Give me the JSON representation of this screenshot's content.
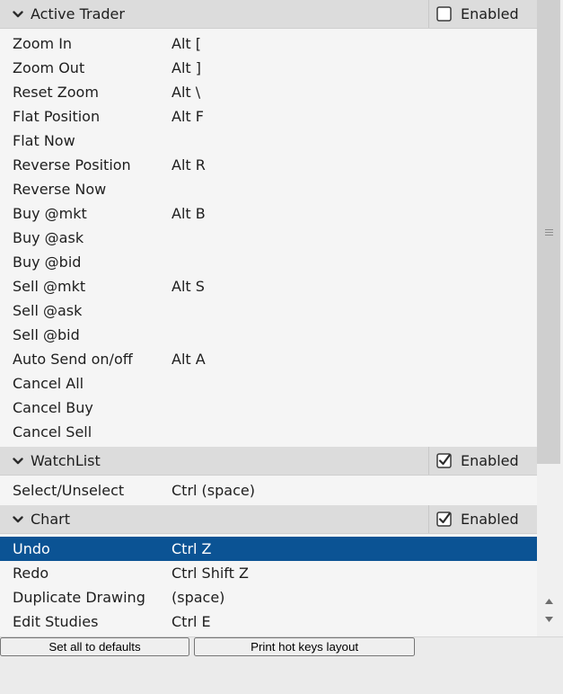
{
  "sections": [
    {
      "title": "Active Trader",
      "enabled": false,
      "enabled_label": "Enabled",
      "rows": [
        {
          "name": "Zoom In",
          "key": "Alt ["
        },
        {
          "name": "Zoom Out",
          "key": "Alt ]"
        },
        {
          "name": "Reset Zoom",
          "key": "Alt \\"
        },
        {
          "name": "Flat Position",
          "key": "Alt F"
        },
        {
          "name": "Flat Now",
          "key": ""
        },
        {
          "name": "Reverse Position",
          "key": "Alt R"
        },
        {
          "name": "Reverse Now",
          "key": ""
        },
        {
          "name": "Buy @mkt",
          "key": "Alt B"
        },
        {
          "name": "Buy @ask",
          "key": ""
        },
        {
          "name": "Buy @bid",
          "key": ""
        },
        {
          "name": "Sell @mkt",
          "key": "Alt S"
        },
        {
          "name": "Sell @ask",
          "key": ""
        },
        {
          "name": "Sell @bid",
          "key": ""
        },
        {
          "name": "Auto Send on/off",
          "key": "Alt A"
        },
        {
          "name": "Cancel All",
          "key": ""
        },
        {
          "name": "Cancel Buy",
          "key": ""
        },
        {
          "name": "Cancel Sell",
          "key": ""
        }
      ]
    },
    {
      "title": "WatchList",
      "enabled": true,
      "enabled_label": "Enabled",
      "rows": [
        {
          "name": "Select/Unselect",
          "key": "Ctrl (space)"
        }
      ]
    },
    {
      "title": "Chart",
      "enabled": true,
      "enabled_label": "Enabled",
      "rows": [
        {
          "name": "Undo",
          "key": "Ctrl Z",
          "selected": true
        },
        {
          "name": "Redo",
          "key": "Ctrl Shift Z"
        },
        {
          "name": "Duplicate Drawing",
          "key": "(space)"
        },
        {
          "name": "Edit Studies",
          "key": "Ctrl E"
        }
      ]
    }
  ],
  "icons": {
    "expand": "chevron-down-icon",
    "checkbox_checked": "checkbox-checked-icon",
    "checkbox_unchecked": "checkbox-unchecked-icon",
    "scroll_grip": "grip-icon",
    "scroll_up": "arrow-up-icon",
    "scroll_down": "arrow-down-icon"
  },
  "scroll": {
    "position": 0.0,
    "visible_fraction": 0.72
  },
  "footer": {
    "defaults_label": "Set all to defaults",
    "print_label": "Print hot keys layout"
  },
  "colors": {
    "header_bg": "#dcdcdc",
    "list_bg": "#f5f5f5",
    "selected_bg": "#0b5394",
    "selected_text": "#ffffff",
    "text": "#1e1e1e"
  }
}
